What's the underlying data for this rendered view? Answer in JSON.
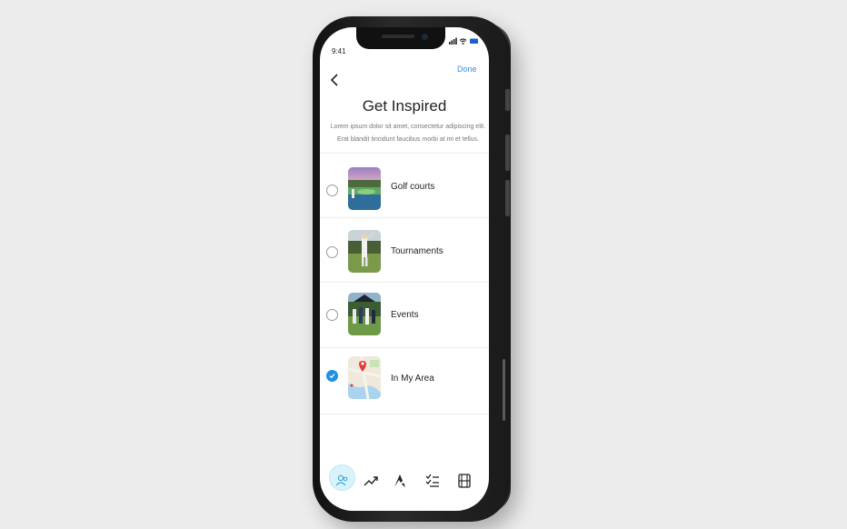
{
  "status": {
    "time": "9:41"
  },
  "header": {
    "done_label": "Done"
  },
  "page": {
    "title": "Get Inspired",
    "subtitle": "Lorem ipsum dolor sit amet, consectetur adipiscing elit. Erat blandit tincidunt faucibus morbi at mi et tellus."
  },
  "options": [
    {
      "label": "Golf courts",
      "selected": false
    },
    {
      "label": "Tournaments",
      "selected": false
    },
    {
      "label": "Events",
      "selected": false
    },
    {
      "label": "In My Area",
      "selected": true
    }
  ],
  "tabs": [
    {
      "icon": "people-icon",
      "active": true
    },
    {
      "icon": "trending-icon",
      "active": false
    },
    {
      "icon": "logo-icon",
      "active": false
    },
    {
      "icon": "checklist-icon",
      "active": false
    },
    {
      "icon": "film-icon",
      "active": false
    }
  ],
  "colors": {
    "accent": "#1e90e6",
    "link": "#3a8ee6",
    "active_tab_bg": "#d9f3fb"
  }
}
